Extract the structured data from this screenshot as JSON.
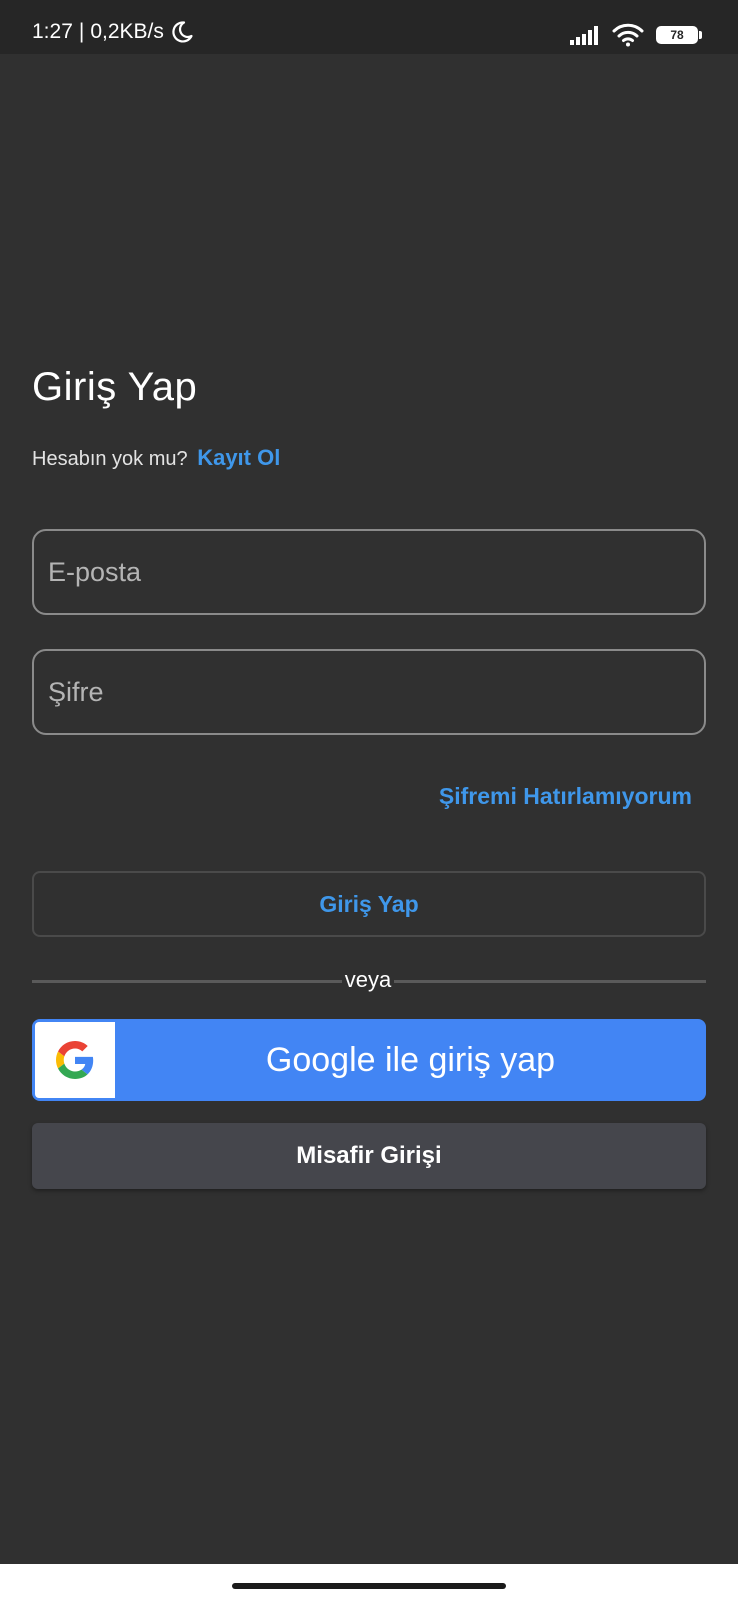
{
  "status_bar": {
    "time": "1:27",
    "separator": "|",
    "network_speed": "0,2KB/s",
    "battery_level": "78",
    "icons": [
      "moon-icon",
      "signal-icon",
      "wifi-icon",
      "battery-icon"
    ]
  },
  "login": {
    "title": "Giriş Yap",
    "no_account_text": "Hesabın yok mu?",
    "signup_link": "Kayıt Ol",
    "email_placeholder": "E-posta",
    "password_placeholder": "Şifre",
    "forgot_password": "Şifremi Hatırlamıyorum",
    "login_button": "Giriş Yap",
    "divider_text": "veya",
    "google_button": "Google ile giriş yap",
    "guest_button": "Misafir Girişi"
  },
  "colors": {
    "background": "#303030",
    "status_bar": "#262626",
    "accent": "#3f97ea",
    "google_blue": "#4285f4",
    "guest_button": "#45464c"
  }
}
